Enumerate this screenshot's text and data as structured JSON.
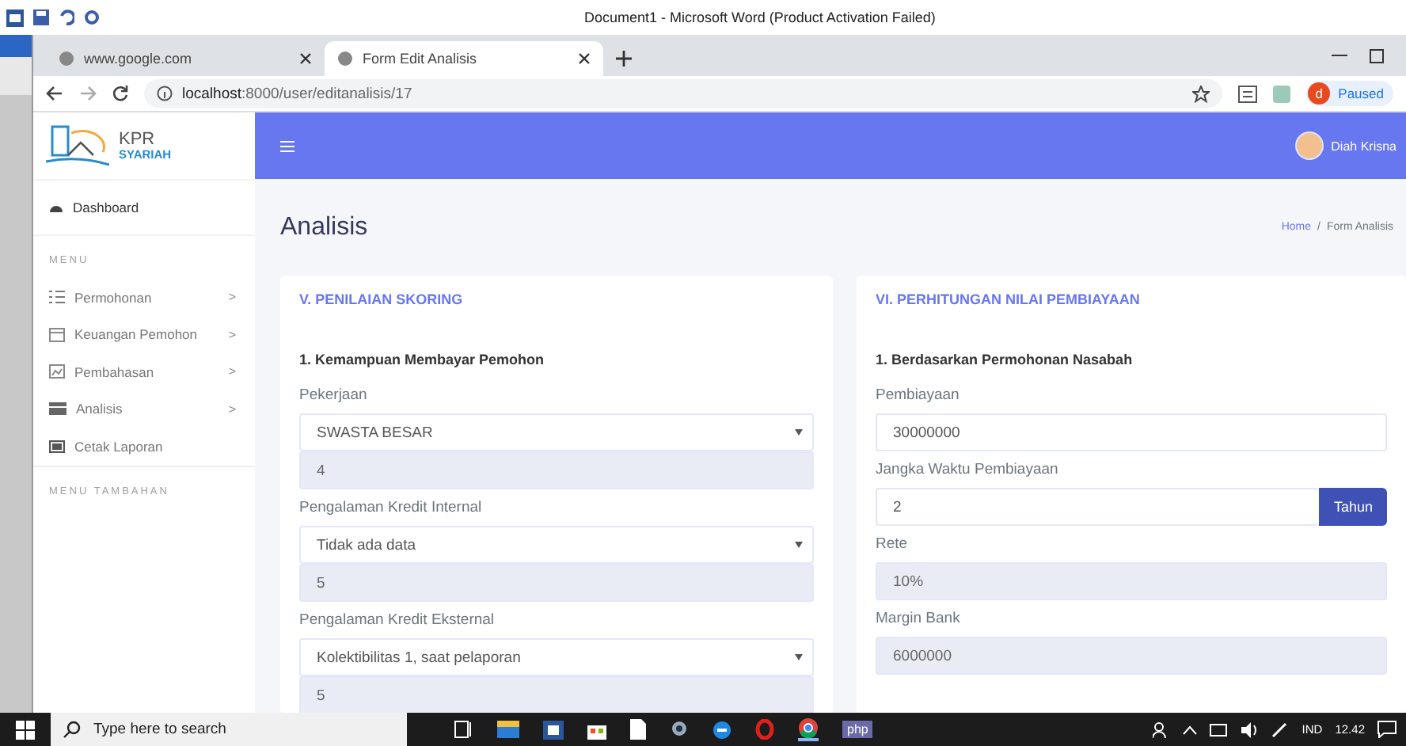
{
  "word": {
    "title": "Document1 - Microsoft Word (Product Activation Failed)"
  },
  "browser": {
    "tabs": [
      {
        "title": "www.google.com",
        "selected": false
      },
      {
        "title": "Form Edit Analisis",
        "selected": true
      }
    ],
    "url_host": "localhost",
    "url_rest": ":8000/user/editanalisis/17",
    "profile_initial": "d",
    "profile_status": "Paused"
  },
  "app": {
    "logo": {
      "line1": "KPR",
      "line2": "SYARIAH"
    },
    "user": "Diah Krisna",
    "sidebar": {
      "dashboard": "Dashboard",
      "sections": [
        {
          "heading": "MENU",
          "items": [
            {
              "label": "Permohonan",
              "chevron": ">"
            },
            {
              "label": "Keuangan Pemohon",
              "chevron": ">"
            },
            {
              "label": "Pembahasan",
              "chevron": ">"
            },
            {
              "label": "Analisis",
              "chevron": ">"
            },
            {
              "label": "Cetak Laporan"
            }
          ]
        },
        {
          "heading": "MENU TAMBAHAN"
        }
      ]
    },
    "page_title": "Analisis",
    "breadcrumb": {
      "items": [
        "Home",
        "Form Analisis"
      ],
      "separator": "/"
    },
    "cards": [
      {
        "title": "V. PENILAIAN SKORING",
        "subtitle": "1. Kemampuan Membayar Pemohon",
        "fields": [
          {
            "kind": "label",
            "text": "Pekerjaan"
          },
          {
            "kind": "select",
            "value": "SWASTA BESAR"
          },
          {
            "kind": "readonly",
            "value": "4"
          },
          {
            "kind": "label",
            "text": "Pengalaman Kredit Internal"
          },
          {
            "kind": "select",
            "value": "Tidak ada data"
          },
          {
            "kind": "readonly",
            "value": "5"
          },
          {
            "kind": "label",
            "text": "Pengalaman Kredit Eksternal"
          },
          {
            "kind": "select",
            "value": "Kolektibilitas 1, saat pelaporan"
          },
          {
            "kind": "readonly",
            "value": "5"
          }
        ]
      },
      {
        "title": "VI. PERHITUNGAN NILAI PEMBIAYAAN",
        "subtitle": "1. Berdasarkan Permohonan Nasabah",
        "fields": [
          {
            "kind": "label",
            "text": "Pembiayaan"
          },
          {
            "kind": "text",
            "value": "30000000"
          },
          {
            "kind": "label",
            "text": "Jangka Waktu Pembiayaan"
          },
          {
            "kind": "addon",
            "value": "2",
            "addon": "Tahun"
          },
          {
            "kind": "label",
            "text": "Rete"
          },
          {
            "kind": "readonly",
            "value": "10%"
          },
          {
            "kind": "label",
            "text": "Margin Bank"
          },
          {
            "kind": "readonly",
            "value": "6000000"
          }
        ]
      }
    ]
  },
  "taskbar": {
    "search_placeholder": "Type here to search",
    "php": "php",
    "language": "IND",
    "time": "12.42"
  }
}
